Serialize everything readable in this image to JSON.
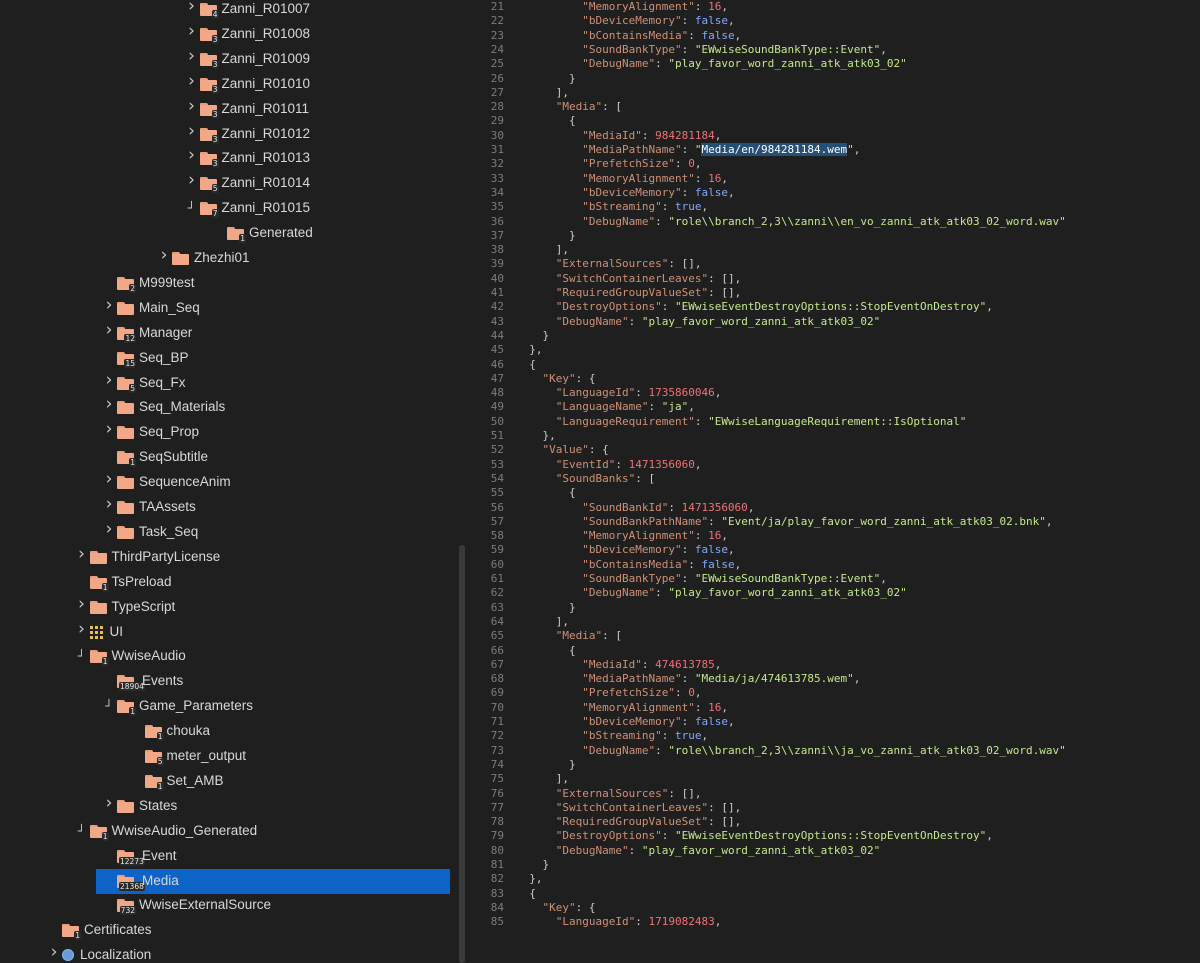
{
  "tree": {
    "items": [
      {
        "label": "Zanni_R01007",
        "badge": "4",
        "depth": 7,
        "chevron": "collapsed"
      },
      {
        "label": "Zanni_R01008",
        "badge": "3",
        "depth": 7,
        "chevron": "collapsed"
      },
      {
        "label": "Zanni_R01009",
        "badge": "3",
        "depth": 7,
        "chevron": "collapsed"
      },
      {
        "label": "Zanni_R01010",
        "badge": "3",
        "depth": 7,
        "chevron": "collapsed"
      },
      {
        "label": "Zanni_R01011",
        "badge": "3",
        "depth": 7,
        "chevron": "collapsed"
      },
      {
        "label": "Zanni_R01012",
        "badge": "3",
        "depth": 7,
        "chevron": "collapsed"
      },
      {
        "label": "Zanni_R01013",
        "badge": "3",
        "depth": 7,
        "chevron": "collapsed"
      },
      {
        "label": "Zanni_R01014",
        "badge": "5",
        "depth": 7,
        "chevron": "collapsed"
      },
      {
        "label": "Zanni_R01015",
        "badge": "7",
        "depth": 7,
        "chevron": "expanded"
      },
      {
        "label": "Generated",
        "badge": "1",
        "depth": 8,
        "chevron": "none"
      },
      {
        "label": "Zhezhi01",
        "badge": "",
        "depth": 6,
        "chevron": "collapsed"
      },
      {
        "label": "M999test",
        "badge": "2",
        "depth": 4,
        "chevron": "none"
      },
      {
        "label": "Main_Seq",
        "badge": "",
        "depth": 4,
        "chevron": "collapsed"
      },
      {
        "label": "Manager",
        "badge": "12",
        "depth": 4,
        "chevron": "collapsed"
      },
      {
        "label": "Seq_BP",
        "badge": "15",
        "depth": 4,
        "chevron": "none"
      },
      {
        "label": "Seq_Fx",
        "badge": "5",
        "depth": 4,
        "chevron": "collapsed"
      },
      {
        "label": "Seq_Materials",
        "badge": "",
        "depth": 4,
        "chevron": "collapsed"
      },
      {
        "label": "Seq_Prop",
        "badge": "",
        "depth": 4,
        "chevron": "collapsed"
      },
      {
        "label": "SeqSubtitle",
        "badge": "1",
        "depth": 4,
        "chevron": "none"
      },
      {
        "label": "SequenceAnim",
        "badge": "",
        "depth": 4,
        "chevron": "collapsed"
      },
      {
        "label": "TAAssets",
        "badge": "",
        "depth": 4,
        "chevron": "collapsed"
      },
      {
        "label": "Task_Seq",
        "badge": "",
        "depth": 4,
        "chevron": "collapsed"
      },
      {
        "label": "ThirdPartyLicense",
        "badge": "",
        "depth": 3,
        "chevron": "collapsed"
      },
      {
        "label": "TsPreload",
        "badge": "1",
        "depth": 3,
        "chevron": "none"
      },
      {
        "label": "TypeScript",
        "badge": "",
        "depth": 3,
        "chevron": "collapsed"
      },
      {
        "label": "UI",
        "badge": "",
        "depth": 3,
        "chevron": "collapsed",
        "icon": "grid-icon"
      },
      {
        "label": "WwiseAudio",
        "badge": "1",
        "depth": 3,
        "chevron": "expanded"
      },
      {
        "label": "Events",
        "badge": "18904",
        "depth": 4,
        "chevron": "none"
      },
      {
        "label": "Game_Parameters",
        "badge": "1",
        "depth": 4,
        "chevron": "expanded"
      },
      {
        "label": "chouka",
        "badge": "1",
        "depth": 5,
        "chevron": "none"
      },
      {
        "label": "meter_output",
        "badge": "5",
        "depth": 5,
        "chevron": "none"
      },
      {
        "label": "Set_AMB",
        "badge": "1",
        "depth": 5,
        "chevron": "none"
      },
      {
        "label": "States",
        "badge": "",
        "depth": 4,
        "chevron": "collapsed"
      },
      {
        "label": "WwiseAudio_Generated",
        "badge": "1",
        "depth": 3,
        "chevron": "expanded"
      },
      {
        "label": "Event",
        "badge": "12273",
        "depth": 4,
        "chevron": "none"
      },
      {
        "label": "Media",
        "badge": "21368",
        "depth": 4,
        "chevron": "none",
        "selected": true
      },
      {
        "label": "WwiseExternalSource",
        "badge": "732",
        "depth": 4,
        "chevron": "none"
      },
      {
        "label": "Certificates",
        "badge": "1",
        "depth": 2,
        "chevron": "none"
      },
      {
        "label": "Localization",
        "badge": "",
        "depth": 2,
        "chevron": "collapsed",
        "icon": "globe-icon"
      }
    ]
  },
  "editor": {
    "first_line": 21,
    "selected_text": "Media/en/984281184.wem",
    "lines": [
      "          \"MemoryAlignment\": 16,",
      "          \"bDeviceMemory\": false,",
      "          \"bContainsMedia\": false,",
      "          \"SoundBankType\": \"EWwiseSoundBankType::Event\",",
      "          \"DebugName\": \"play_favor_word_zanni_atk_atk03_02\"",
      "        }",
      "      ],",
      "      \"Media\": [",
      "        {",
      "          \"MediaId\": 984281184,",
      "          \"MediaPathName\": \"Media/en/984281184.wem\",",
      "          \"PrefetchSize\": 0,",
      "          \"MemoryAlignment\": 16,",
      "          \"bDeviceMemory\": false,",
      "          \"bStreaming\": true,",
      "          \"DebugName\": \"role\\\\branch_2,3\\\\zanni\\\\en_vo_zanni_atk_atk03_02_word.wav\"",
      "        }",
      "      ],",
      "      \"ExternalSources\": [],",
      "      \"SwitchContainerLeaves\": [],",
      "      \"RequiredGroupValueSet\": [],",
      "      \"DestroyOptions\": \"EWwiseEventDestroyOptions::StopEventOnDestroy\",",
      "      \"DebugName\": \"play_favor_word_zanni_atk_atk03_02\"",
      "    }",
      "  },",
      "  {",
      "    \"Key\": {",
      "      \"LanguageId\": 1735860046,",
      "      \"LanguageName\": \"ja\",",
      "      \"LanguageRequirement\": \"EWwiseLanguageRequirement::IsOptional\"",
      "    },",
      "    \"Value\": {",
      "      \"EventId\": 1471356060,",
      "      \"SoundBanks\": [",
      "        {",
      "          \"SoundBankId\": 1471356060,",
      "          \"SoundBankPathName\": \"Event/ja/play_favor_word_zanni_atk_atk03_02.bnk\",",
      "          \"MemoryAlignment\": 16,",
      "          \"bDeviceMemory\": false,",
      "          \"bContainsMedia\": false,",
      "          \"SoundBankType\": \"EWwiseSoundBankType::Event\",",
      "          \"DebugName\": \"play_favor_word_zanni_atk_atk03_02\"",
      "        }",
      "      ],",
      "      \"Media\": [",
      "        {",
      "          \"MediaId\": 474613785,",
      "          \"MediaPathName\": \"Media/ja/474613785.wem\",",
      "          \"PrefetchSize\": 0,",
      "          \"MemoryAlignment\": 16,",
      "          \"bDeviceMemory\": false,",
      "          \"bStreaming\": true,",
      "          \"DebugName\": \"role\\\\branch_2,3\\\\zanni\\\\ja_vo_zanni_atk_atk03_02_word.wav\"",
      "        }",
      "      ],",
      "      \"ExternalSources\": [],",
      "      \"SwitchContainerLeaves\": [],",
      "      \"RequiredGroupValueSet\": [],",
      "      \"DestroyOptions\": \"EWwiseEventDestroyOptions::StopEventOnDestroy\",",
      "      \"DebugName\": \"play_favor_word_zanni_atk_atk03_02\"",
      "    }",
      "  },",
      "  {",
      "    \"Key\": {",
      "      \"LanguageId\": 1719082483,"
    ]
  },
  "colors": {
    "background": "#1f1f1f",
    "selection": "#0e63c6",
    "folder": "#f2a887",
    "json_key": "#ce9178",
    "json_string": "#c3e88d",
    "json_number": "#f07178",
    "json_bool": "#82aaff"
  }
}
